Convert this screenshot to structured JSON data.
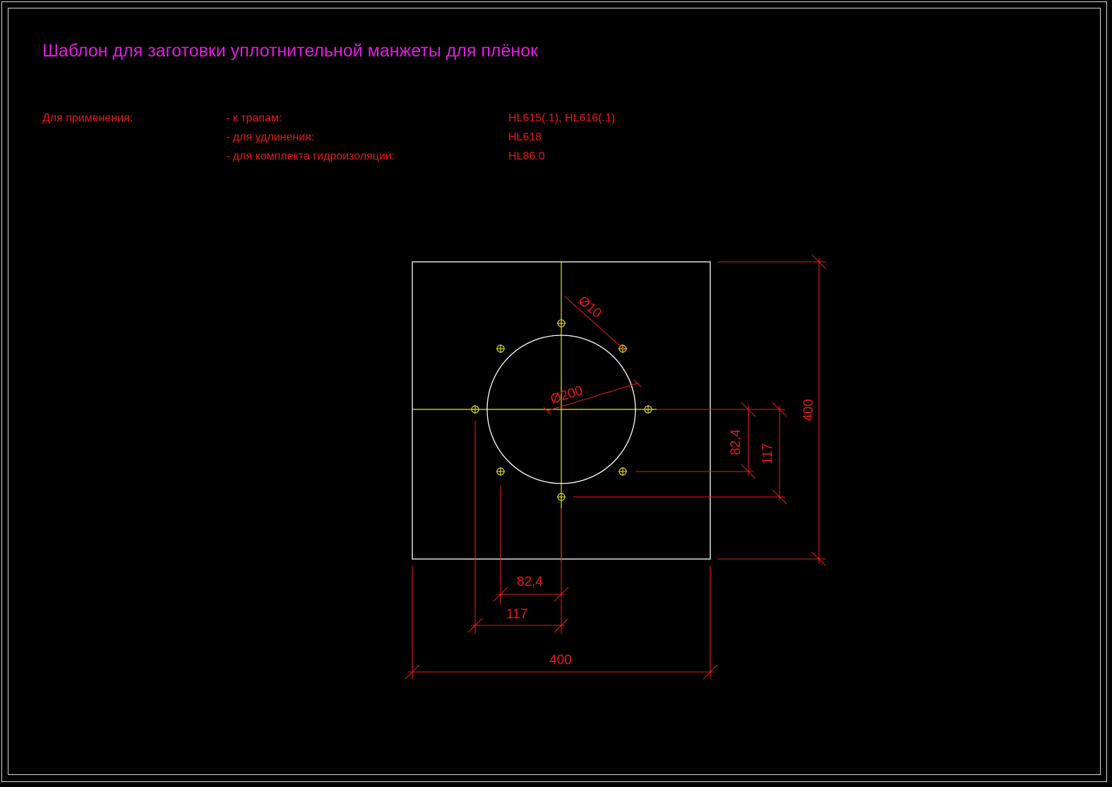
{
  "title": "Шаблон для заготовки уплотнительной манжеты для плёнок",
  "application": {
    "label": "Для применения:",
    "rows": [
      {
        "purpose": "- к трапам:",
        "models": "HL615(.1), HL616(.1)"
      },
      {
        "purpose": "- для удлинения:",
        "models": "HL618"
      },
      {
        "purpose": "- для комплекта гидроизоляции:",
        "models": "HL86.0"
      }
    ]
  },
  "dimensions": {
    "plate_width": "400",
    "plate_height": "400",
    "center_hole_diameter": "Ø200",
    "bolt_hole_diameter": "Ø10",
    "horizontal_short": "82,4",
    "horizontal_long": "117",
    "vertical_short": "82,4",
    "vertical_long": "117"
  },
  "colors": {
    "background": "#000000",
    "frame": "#d8d8d8",
    "title": "#e01ce0",
    "text": "#e61a1a",
    "dimension": "#e61a1a",
    "outline": "#ffffff",
    "centerline": "#e6e61a"
  }
}
